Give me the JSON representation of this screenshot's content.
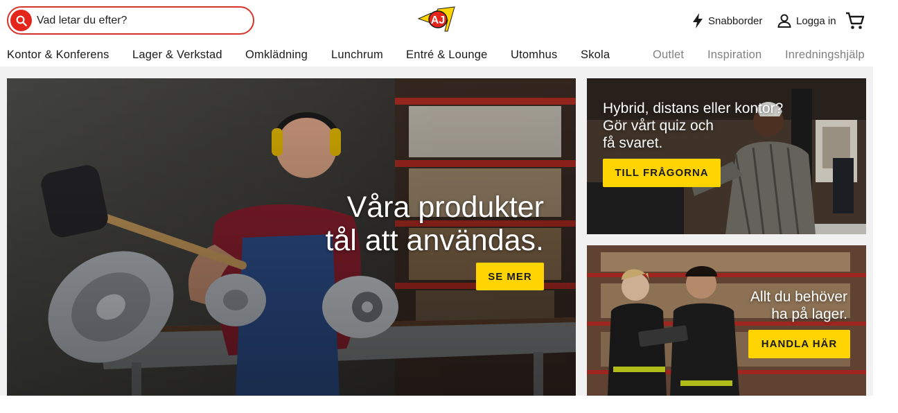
{
  "header": {
    "search": {
      "placeholder": "Vad letar du efter?"
    },
    "logo_text": "AJ",
    "quick_order_label": "Snabborder",
    "login_label": "Logga in"
  },
  "nav": {
    "items": [
      "Kontor & Konferens",
      "Lager & Verkstad",
      "Omklädning",
      "Lunchrum",
      "Entré & Lounge",
      "Utomhus",
      "Skola"
    ],
    "secondary": [
      "Outlet",
      "Inspiration",
      "Inredningshjälp"
    ]
  },
  "hero": {
    "headline_line1": "Våra produkter",
    "headline_line2": "tål att användas.",
    "cta_label": "SE MER"
  },
  "quiz_banner": {
    "line1": "Hybrid, distans eller kontor?",
    "line2": "Gör vårt quiz och",
    "line3": "få svaret.",
    "cta_label": "TILL FRÅGORNA"
  },
  "stock_banner": {
    "line1": "Allt du behöver",
    "line2": "ha på lager.",
    "cta_label": "HANDLA HÄR"
  },
  "colors": {
    "brand_red": "#e3251b",
    "brand_yellow": "#ffd400",
    "muted_nav": "#808080"
  },
  "icons": [
    "search-icon",
    "bolt-icon",
    "user-icon",
    "cart-icon"
  ]
}
